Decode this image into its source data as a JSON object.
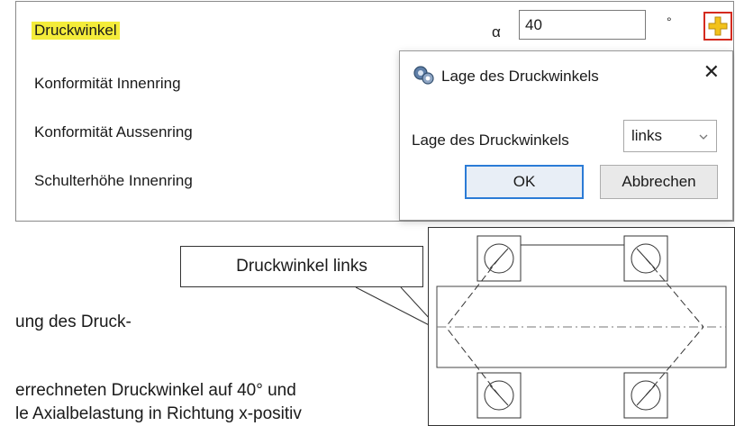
{
  "properties": {
    "rows": [
      {
        "label": "Druckwinkel"
      },
      {
        "label": "Konformität Innenring"
      },
      {
        "label": "Konformität Aussenring"
      },
      {
        "label": "Schulterhöhe Innenring"
      }
    ],
    "symbol": "α",
    "value": "40",
    "unit": "°",
    "add_icon": "plus-icon",
    "colors": {
      "highlight": "#f4ec3a",
      "add_border": "#d42a1f",
      "add_plus": "#f2c21b"
    }
  },
  "dialog": {
    "icon": "gears-icon",
    "title": "Lage des Druckwinkels",
    "close": "✕",
    "field_label": "Lage des Druckwinkels",
    "select_value": "links",
    "ok_label": "OK",
    "cancel_label": "Abbrechen",
    "colors": {
      "ok_border": "#2b7bd6"
    }
  },
  "document": {
    "callout": "Druckwinkel links",
    "line1": "ung des Druck-",
    "line2": "errechneten Druckwinkel auf 40° und",
    "line3": "le Axialbelastung in Richtung x-positiv"
  }
}
